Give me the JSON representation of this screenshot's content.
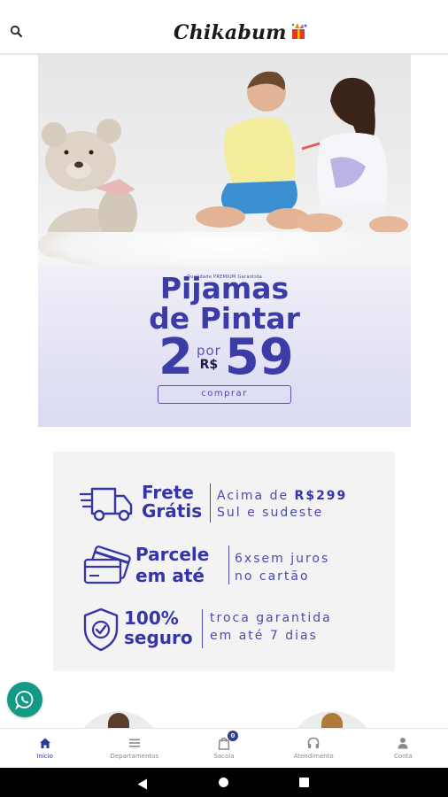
{
  "header": {
    "logo_text": "Chikabum",
    "search_icon": "search-icon"
  },
  "hero": {
    "small_tag": "Qualidade PREMIUM Garantida",
    "title_line1": "Pijamas",
    "title_line2": "de Pintar",
    "price_qty": "2",
    "price_por": "por",
    "price_currency": "R$",
    "price_value": "59",
    "buy_label": "comprar"
  },
  "benefits": [
    {
      "icon": "delivery-truck-icon",
      "title_line1": "Frete",
      "title_line2": "Grátis",
      "desc_line1_prefix": "Acima de ",
      "desc_line1_bold": "R$299",
      "desc_line2": "Sul e sudeste"
    },
    {
      "icon": "credit-card-icon",
      "title_line1": "Parcele",
      "title_line2": "em até",
      "desc_line1": "6xsem juros",
      "desc_line2": "no cartão"
    },
    {
      "icon": "shield-check-icon",
      "title_line1": "100%",
      "title_line2": "seguro",
      "desc_line1": "troca garantida",
      "desc_line2": "em até 7 dias"
    }
  ],
  "bottom_nav": [
    {
      "label": "Início",
      "icon": "home-icon"
    },
    {
      "label": "Departamentos",
      "icon": "list-icon"
    },
    {
      "label": "Sacola",
      "icon": "shopping-bag-icon",
      "badge": "0"
    },
    {
      "label": "Atendimento",
      "icon": "headphones-icon"
    },
    {
      "label": "Conta",
      "icon": "person-icon"
    }
  ],
  "colors": {
    "brand_blue": "#3c3ca8",
    "whatsapp_green": "#129a84",
    "nav_active": "#2a3b8f"
  }
}
